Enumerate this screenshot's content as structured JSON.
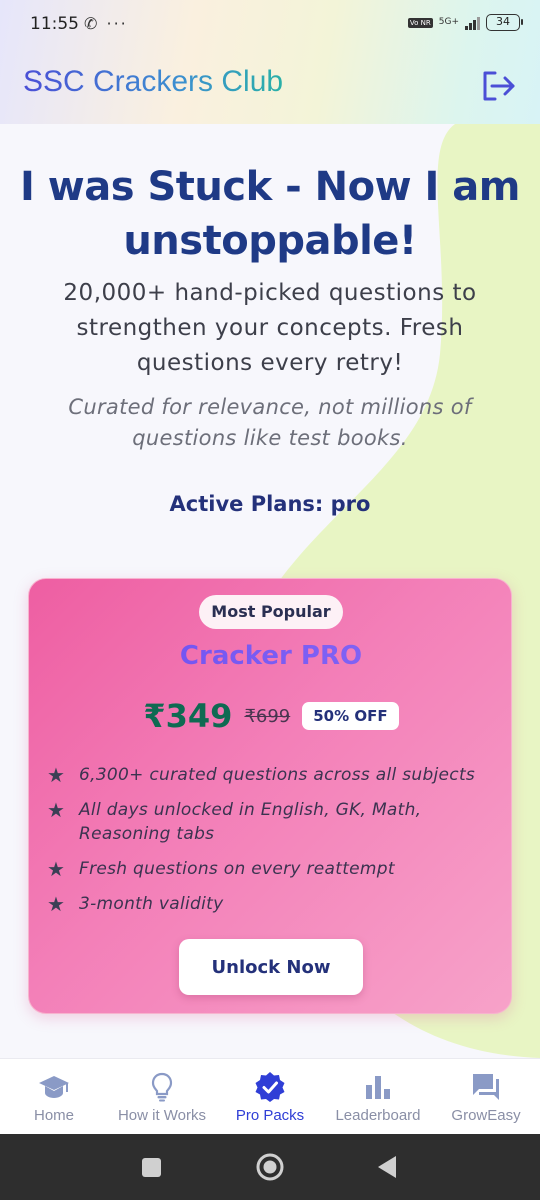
{
  "status_bar": {
    "time": "11:55",
    "left_icons": "✆ ···",
    "network_tag": "Vo NR",
    "signal_label": "5G+",
    "battery": "34"
  },
  "header": {
    "app_title": "SSC Crackers Club",
    "logout_icon": "logout-icon"
  },
  "hero": {
    "headline": "I was Stuck - Now I am unstoppable!",
    "subtext": "20,000+ hand-picked questions to strengthen your concepts. Fresh questions every retry!",
    "note": "Curated for relevance, not millions of questions like test books.",
    "active_plans": "Active Plans: pro"
  },
  "plan_card": {
    "badge": "Most Popular",
    "name": "Cracker PRO",
    "price": "₹349",
    "original_price": "₹699",
    "discount": "50% OFF",
    "features": [
      "6,300+ curated questions across all subjects",
      "All days unlocked in English, GK, Math, Reasoning tabs",
      "Fresh questions on every reattempt",
      "3-month validity"
    ],
    "cta": "Unlock Now"
  },
  "bottom_nav": {
    "items": [
      {
        "label": "Home",
        "icon": "graduation-cap-icon",
        "active": false
      },
      {
        "label": "How it Works",
        "icon": "lightbulb-icon",
        "active": false
      },
      {
        "label": "Pro Packs",
        "icon": "verified-badge-icon",
        "active": true
      },
      {
        "label": "Leaderboard",
        "icon": "bar-chart-icon",
        "active": false
      },
      {
        "label": "GrowEasy",
        "icon": "chat-icon",
        "active": false
      }
    ]
  },
  "colors": {
    "brand_blue": "#1f3a86",
    "accent_pink": "#ee5ea2",
    "active_nav": "#2f3ed6",
    "price_green": "#0f6a52"
  }
}
